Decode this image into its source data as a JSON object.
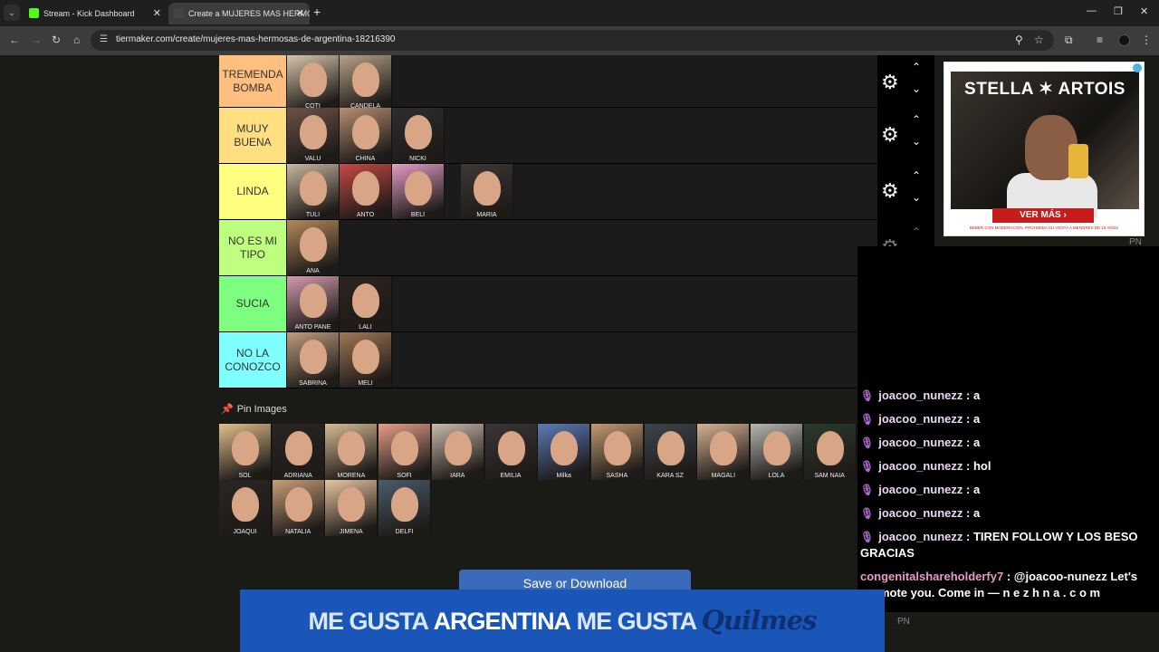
{
  "browser": {
    "tabs": [
      {
        "title": "Stream - Kick Dashboard",
        "favicon_color": "#53fc18"
      },
      {
        "title": "Create a MUJERES MAS HERMOS",
        "favicon_color": "#444444"
      }
    ],
    "url": "tiermaker.com/create/mujeres-mas-hermosas-de-argentina-18216390"
  },
  "tiers": [
    {
      "label": "TREMENDA BOMBA",
      "color": "#ffbf7f",
      "images": [
        {
          "name": "COTI",
          "color": "#d8c6aa"
        },
        {
          "name": "CANDELA",
          "color": "#b9a289"
        }
      ]
    },
    {
      "label": "MUUY BUENA",
      "color": "#ffdf7f",
      "images": [
        {
          "name": "VALU",
          "color": "#6e5245"
        },
        {
          "name": "CHINA",
          "color": "#b88f73"
        },
        {
          "name": "NICKI",
          "color": "#2d2c30"
        }
      ]
    },
    {
      "label": "LINDA",
      "color": "#ffff7f",
      "images": [
        {
          "name": "TULI",
          "color": "#c8b89e"
        },
        {
          "name": "ANTO",
          "color": "#c74a45"
        },
        {
          "name": "BELI",
          "color": "#e59ec5"
        },
        {
          "name": "MARIA",
          "color": "#3e3836"
        }
      ]
    },
    {
      "label": "NO ES MI TIPO",
      "color": "#bfff7f",
      "images": [
        {
          "name": "ANA",
          "color": "#b38a5a"
        }
      ]
    },
    {
      "label": "SUCIA",
      "color": "#7fff7f",
      "images": [
        {
          "name": "ANTO PANE",
          "color": "#d69cb1"
        },
        {
          "name": "LALI",
          "color": "#2d2420"
        }
      ]
    },
    {
      "label": "NO LA CONOZCO",
      "color": "#7fffff",
      "images": [
        {
          "name": "SABRINA",
          "color": "#bf9d7c"
        },
        {
          "name": "MELI",
          "color": "#a17853"
        }
      ]
    }
  ],
  "pin_images": {
    "label": "Pin Images",
    "images": [
      {
        "name": "SOL",
        "color": "#e2c08c"
      },
      {
        "name": "ADRIANA",
        "color": "#2b2521"
      },
      {
        "name": "MORENA",
        "color": "#d9bb95"
      },
      {
        "name": "SOFI",
        "color": "#e89e88"
      },
      {
        "name": "IARA",
        "color": "#cbb9ac"
      },
      {
        "name": "EMILIA",
        "color": "#3a3637"
      },
      {
        "name": "Milka",
        "color": "#5d7bb8"
      },
      {
        "name": "SASHA",
        "color": "#c39a73"
      },
      {
        "name": "KARA SZ",
        "color": "#3d454d"
      },
      {
        "name": "MAGALI",
        "color": "#d7b394"
      },
      {
        "name": "LOLA",
        "color": "#b7b7b0"
      },
      {
        "name": "SAM NAIA",
        "color": "#2c3a2c"
      },
      {
        "name": "JOAQUI",
        "color": "#2a2624"
      },
      {
        "name": "NATALIA",
        "color": "#c99f79"
      },
      {
        "name": "JIMENA",
        "color": "#e9c6a2"
      },
      {
        "name": "DELFI",
        "color": "#4a5d6b"
      }
    ]
  },
  "save_button": "Save or Download",
  "bottom_ad": {
    "part1": "ME GUSTA",
    "part2": "ARGENTINA",
    "part3": "ME GUSTA",
    "brand": "Quilmes"
  },
  "side_ad": {
    "brand": "STELLA ✶ ARTOIS",
    "cta": "VER MÁS",
    "disclaimer": "BEBER CON MODERACIÓN. PROHIBIDA SU VENTA A MENORES DE 18 AÑOS",
    "pn": "PN"
  },
  "chat": [
    {
      "user": "joacoo_nunezz",
      "text": "a",
      "mic": true
    },
    {
      "user": "joacoo_nunezz",
      "text": "a",
      "mic": true
    },
    {
      "user": "joacoo_nunezz",
      "text": "a",
      "mic": true
    },
    {
      "user": "joacoo_nunezz",
      "text": "hol",
      "mic": true
    },
    {
      "user": "joacoo_nunezz",
      "text": "a",
      "mic": true
    },
    {
      "user": "joacoo_nunezz",
      "text": "a",
      "mic": true
    },
    {
      "user": "joacoo_nunezz",
      "text": "TIREN FOLLOW Y LOS BESO GRACIAS",
      "mic": true
    },
    {
      "user": "congenitalshareholderfy7",
      "text": "@joacoo-nunezz Let's promote you. Come in — n e z h n a . c o m",
      "mic": false
    }
  ]
}
